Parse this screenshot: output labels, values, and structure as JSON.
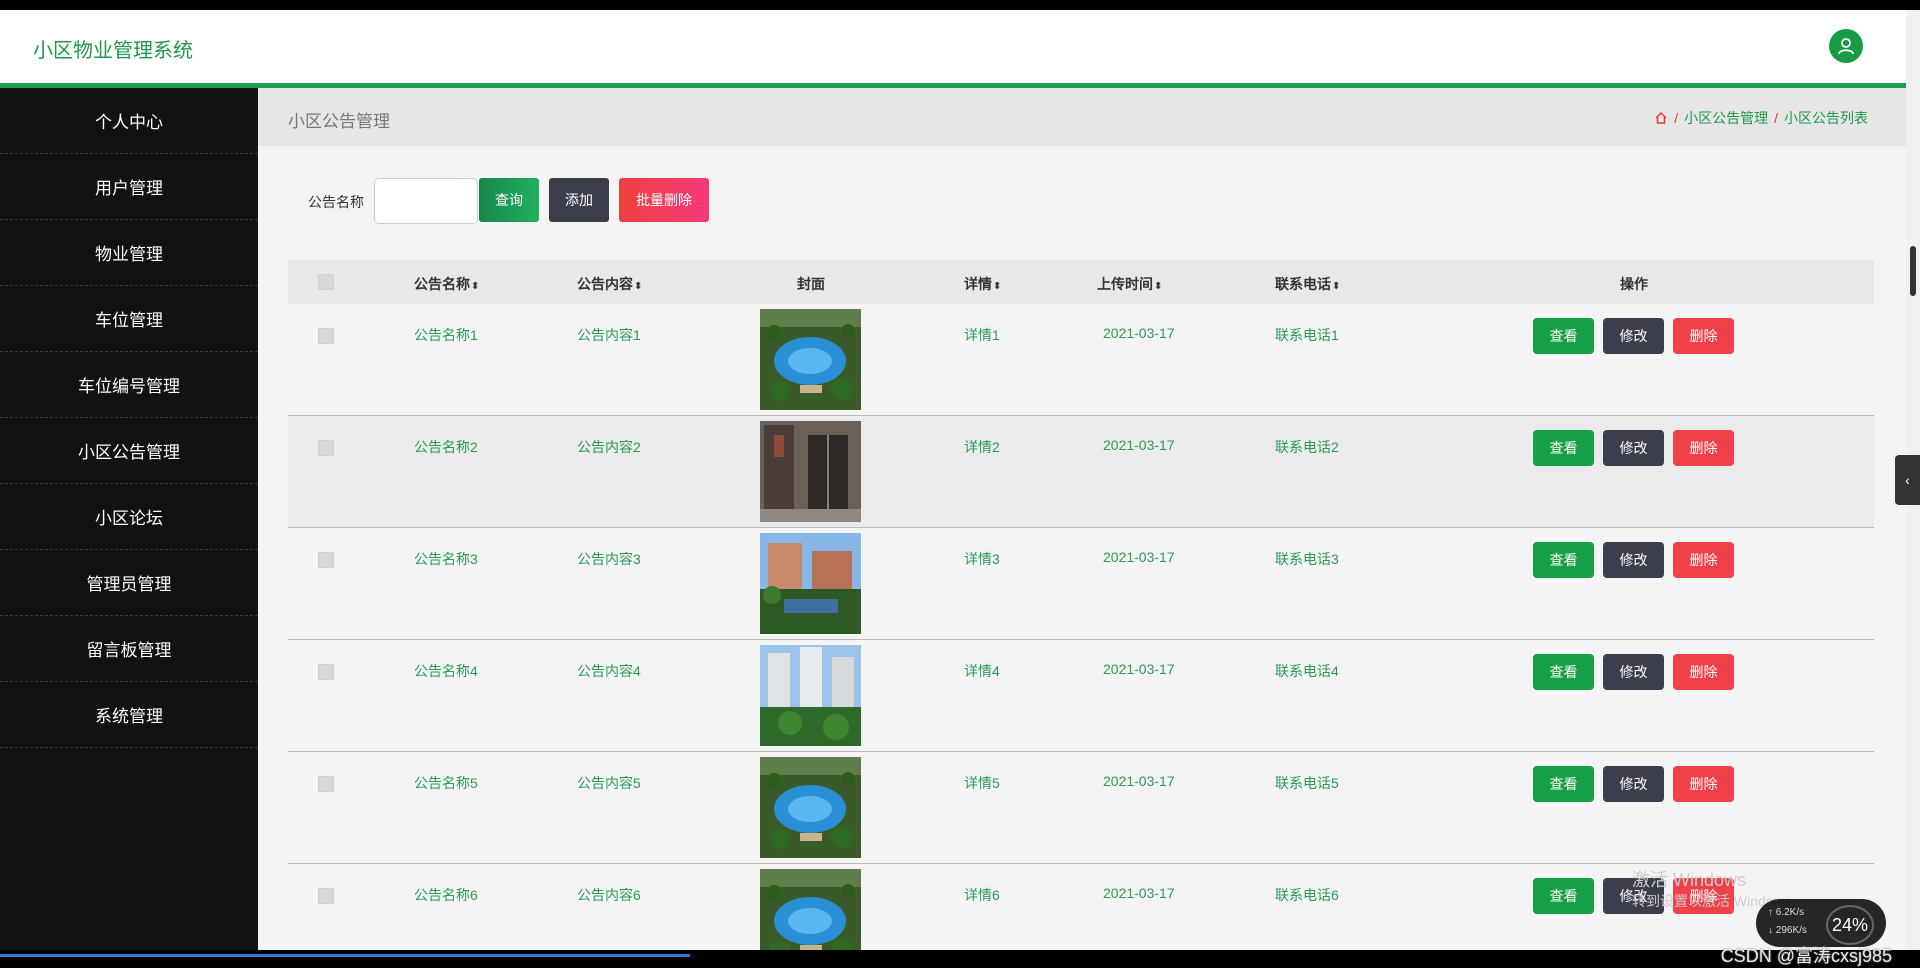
{
  "app": {
    "title": "小区物业管理系统"
  },
  "sidebar": {
    "items": [
      {
        "label": "个人中心"
      },
      {
        "label": "用户管理"
      },
      {
        "label": "物业管理"
      },
      {
        "label": "车位管理"
      },
      {
        "label": "车位编号管理"
      },
      {
        "label": "小区公告管理"
      },
      {
        "label": "小区论坛"
      },
      {
        "label": "管理员管理"
      },
      {
        "label": "留言板管理"
      },
      {
        "label": "系统管理"
      }
    ]
  },
  "page": {
    "title": "小区公告管理",
    "breadcrumb": {
      "home_icon": "home-icon",
      "sep": "/",
      "level1": "小区公告管理",
      "level2": "小区公告列表"
    }
  },
  "search": {
    "label": "公告名称",
    "value": "",
    "query_label": "查询",
    "add_label": "添加",
    "batch_delete_label": "批量删除"
  },
  "table": {
    "headers": {
      "name": "公告名称",
      "content": "公告内容",
      "cover": "封面",
      "detail": "详情",
      "time": "上传时间",
      "phone": "联系电话",
      "ops": "操作"
    },
    "sort_glyph": "⬍",
    "rows": [
      {
        "name": "公告名称1",
        "content": "公告内容1",
        "detail": "详情1",
        "time": "2021-03-17",
        "phone": "联系电话1",
        "cover": "pool"
      },
      {
        "name": "公告名称2",
        "content": "公告内容2",
        "detail": "详情2",
        "time": "2021-03-17",
        "phone": "联系电话2",
        "cover": "elevator"
      },
      {
        "name": "公告名称3",
        "content": "公告内容3",
        "detail": "详情3",
        "time": "2021-03-17",
        "phone": "联系电话3",
        "cover": "buildings"
      },
      {
        "name": "公告名称4",
        "content": "公告内容4",
        "detail": "详情4",
        "time": "2021-03-17",
        "phone": "联系电话4",
        "cover": "towers"
      },
      {
        "name": "公告名称5",
        "content": "公告内容5",
        "detail": "详情5",
        "time": "2021-03-17",
        "phone": "联系电话5",
        "cover": "pool"
      },
      {
        "name": "公告名称6",
        "content": "公告内容6",
        "detail": "详情6",
        "time": "2021-03-17",
        "phone": "联系电话6",
        "cover": "pool"
      }
    ],
    "actions": {
      "view": "查看",
      "edit": "修改",
      "delete": "删除"
    }
  },
  "overlay": {
    "win_activate": "激活 Windows",
    "win_activate_sub": "转到设置以激活 Windows",
    "watermark": "CSDN @富涛cxsj985",
    "net_up": "6.2K/s",
    "net_down": "296K/s",
    "net_pct": "24%"
  },
  "colors": {
    "accent": "#1aa24a",
    "sidebar_bg": "#121212",
    "danger": "#f0404a",
    "dark_btn": "#3c3e4c"
  }
}
